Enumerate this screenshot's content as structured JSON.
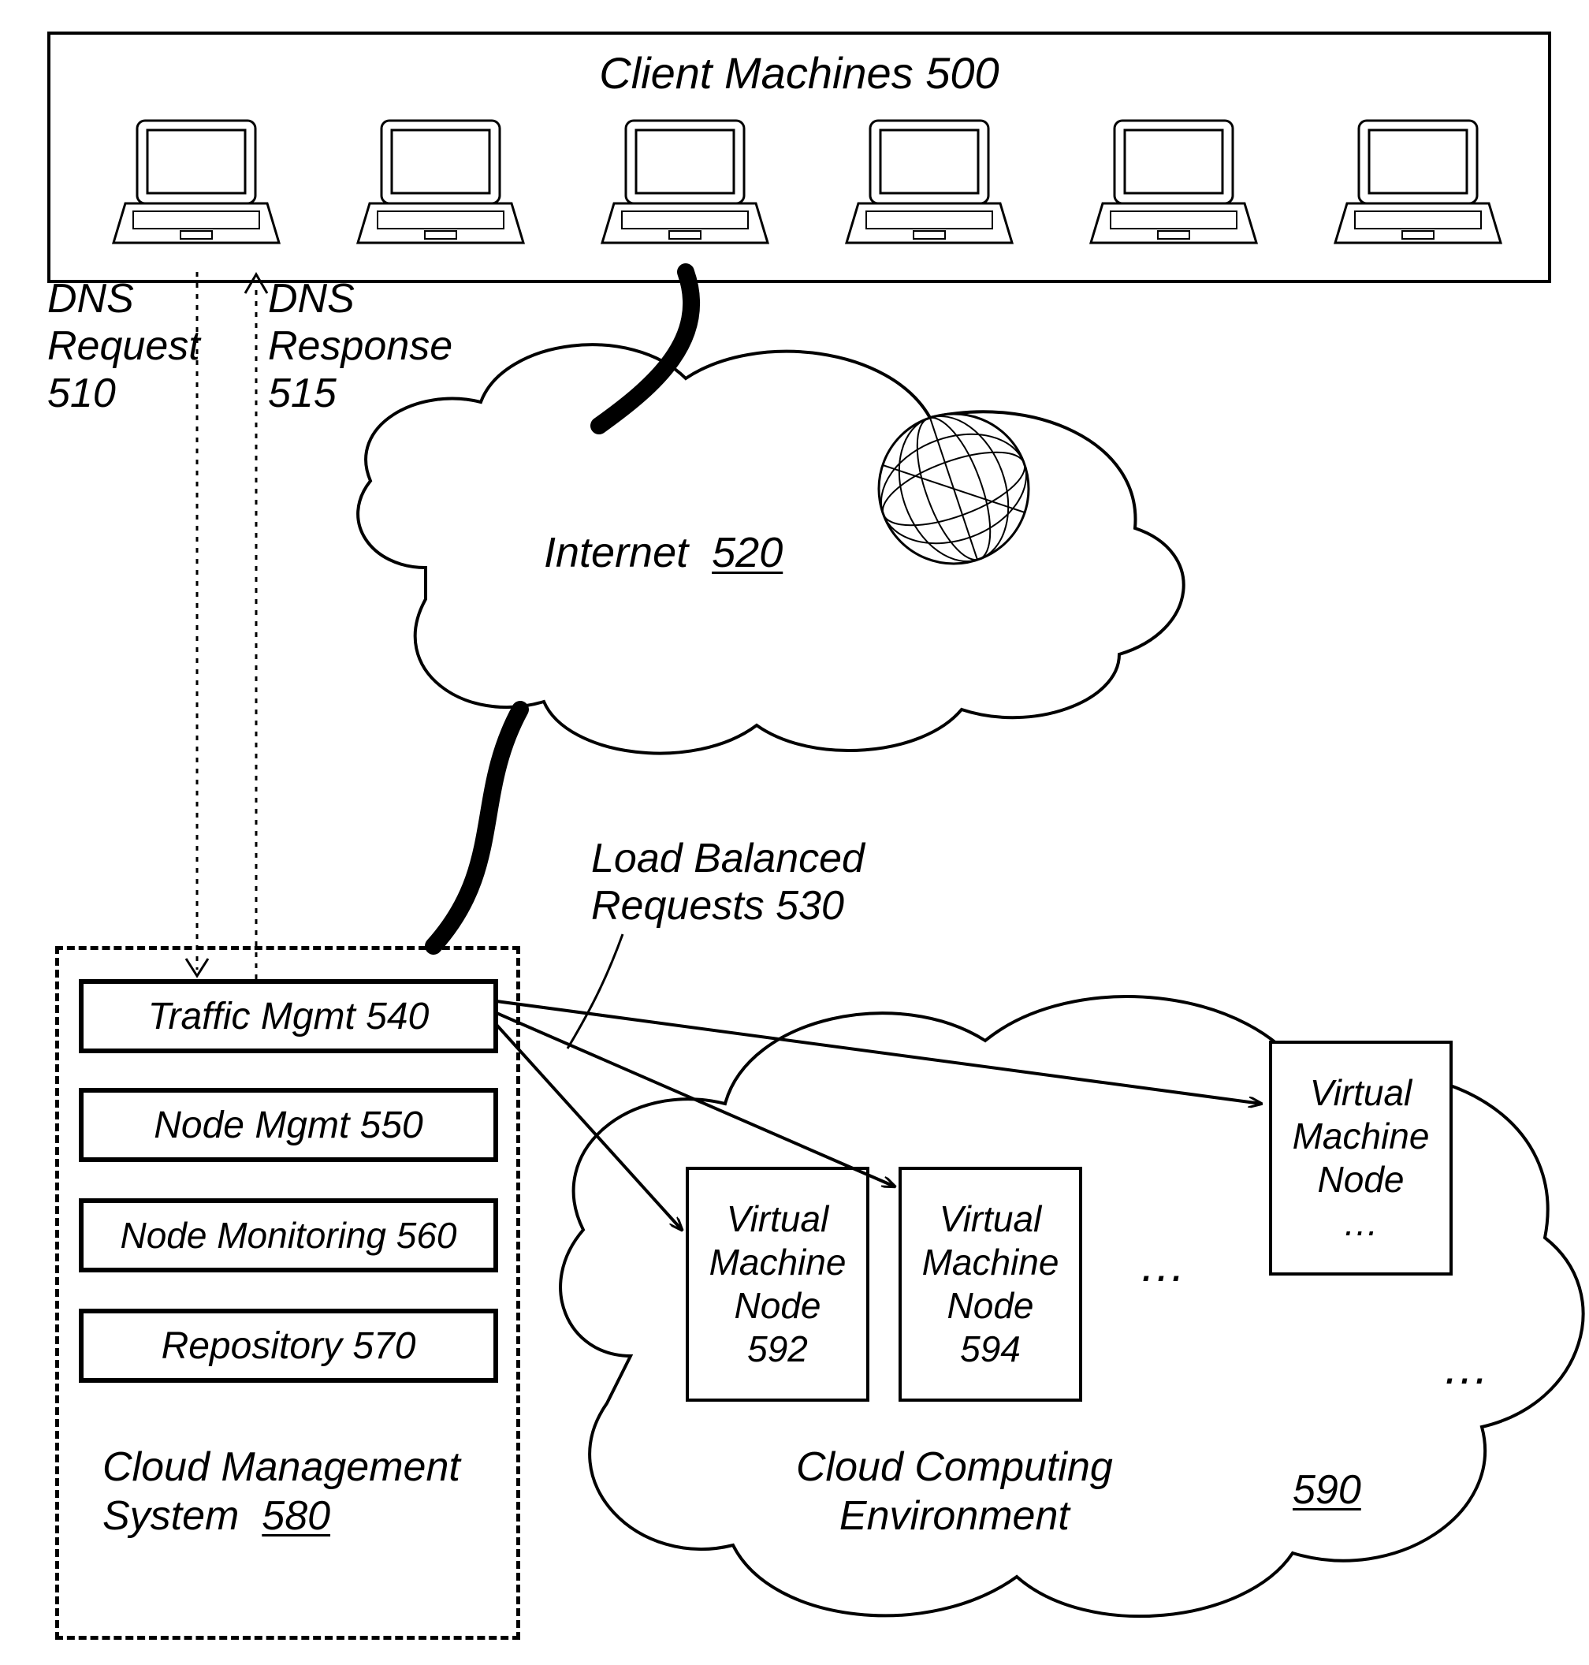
{
  "client_box": {
    "title": "Client Machines 500"
  },
  "dns": {
    "request": "DNS\nRequest\n510",
    "response": "DNS\nResponse\n515"
  },
  "internet": {
    "label": "Internet",
    "num": "520"
  },
  "load_balanced": {
    "label": "Load Balanced\nRequests 530"
  },
  "mgmt": {
    "traffic": "Traffic Mgmt 540",
    "node_mgmt": "Node Mgmt 550",
    "node_monitoring": "Node Monitoring 560",
    "repository": "Repository 570",
    "cloud_mgmt_label": "Cloud Management\nSystem",
    "cloud_mgmt_num": "580"
  },
  "cloud_env": {
    "label": "Cloud Computing\nEnvironment",
    "num": "590"
  },
  "vm": {
    "node1": "Virtual\nMachine\nNode\n592",
    "node2": "Virtual\nMachine\nNode\n594",
    "node3": "Virtual\nMachine\nNode\n…"
  },
  "ellipsis": "…"
}
